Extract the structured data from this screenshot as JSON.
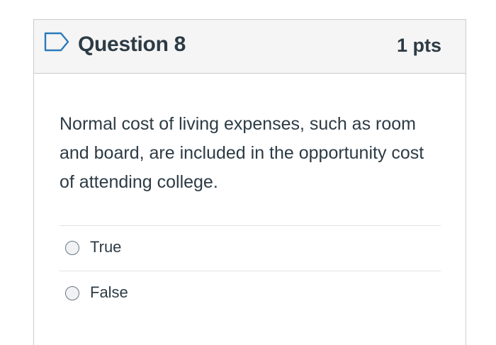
{
  "question": {
    "title": "Question 8",
    "points": "1 pts",
    "flag_icon": "flag-outline-icon",
    "text": "Normal cost of living expenses, such as room and board, are included in the opportunity cost of attending college.",
    "answers": [
      {
        "label": "True",
        "selected": false
      },
      {
        "label": "False",
        "selected": false
      }
    ]
  },
  "colors": {
    "text": "#2d3b45",
    "header_bg": "#f5f5f5",
    "border": "#c7cdd1",
    "flag": "#2b7abc"
  }
}
